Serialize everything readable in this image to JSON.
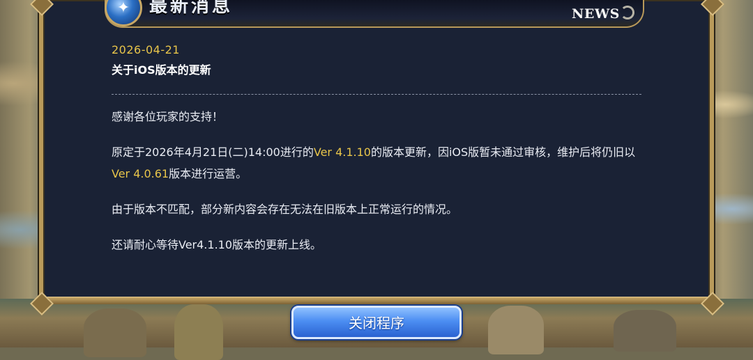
{
  "header": {
    "title": "最新消息",
    "news_label": "NEWS"
  },
  "article": {
    "date": "2026-04-21",
    "title": "关于iOS版本的更新",
    "paragraphs": {
      "p1": "感谢各位玩家的支持！",
      "p2_part1": "原定于2026年4月21日(二)14:00进行的",
      "p2_ver_a": "Ver 4.1.10",
      "p2_part2": "的版本更新，因iOS版暂未通过审核，维护后将仍旧以",
      "p2_ver_b": "Ver 4.0.61",
      "p2_part3": "版本进行运营。",
      "p3": "由于版本不匹配，部分新内容会存在无法在旧版本上正常运行的情况。",
      "p4": "还请耐心等待Ver4.1.10版本的更新上线。"
    }
  },
  "footer": {
    "close_button": "关闭程序"
  },
  "colors": {
    "panel_bg": "#1a2235",
    "highlight": "#e8c54a",
    "button_blue": "#4c8ef2",
    "frame_gold": "#b89a5a"
  },
  "icons": {
    "header_orb": "globe-orb-icon",
    "news_swirl": "swirl-icon"
  }
}
